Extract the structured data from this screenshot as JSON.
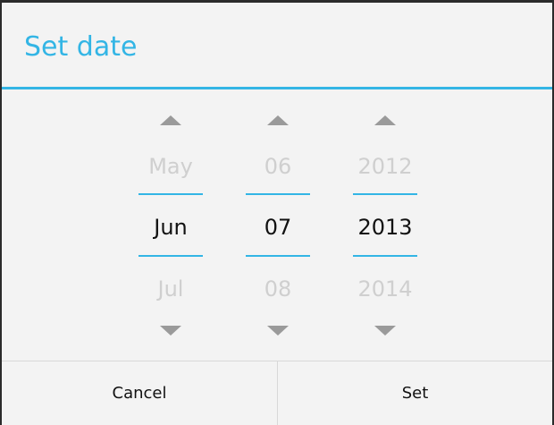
{
  "dialog": {
    "title": "Set date"
  },
  "picker": {
    "month": {
      "prev": "May",
      "current": "Jun",
      "next": "Jul"
    },
    "day": {
      "prev": "06",
      "current": "07",
      "next": "08"
    },
    "year": {
      "prev": "2012",
      "current": "2013",
      "next": "2014"
    }
  },
  "buttons": {
    "cancel_label": "Cancel",
    "set_label": "Set"
  },
  "icons": {
    "increment": "chevron-up-icon",
    "decrement": "chevron-down-icon"
  },
  "colors": {
    "accent": "#33b5e5",
    "dialog_background": "#f3f3f3",
    "inactive_text": "#cfcfcf",
    "active_text": "#111111"
  }
}
